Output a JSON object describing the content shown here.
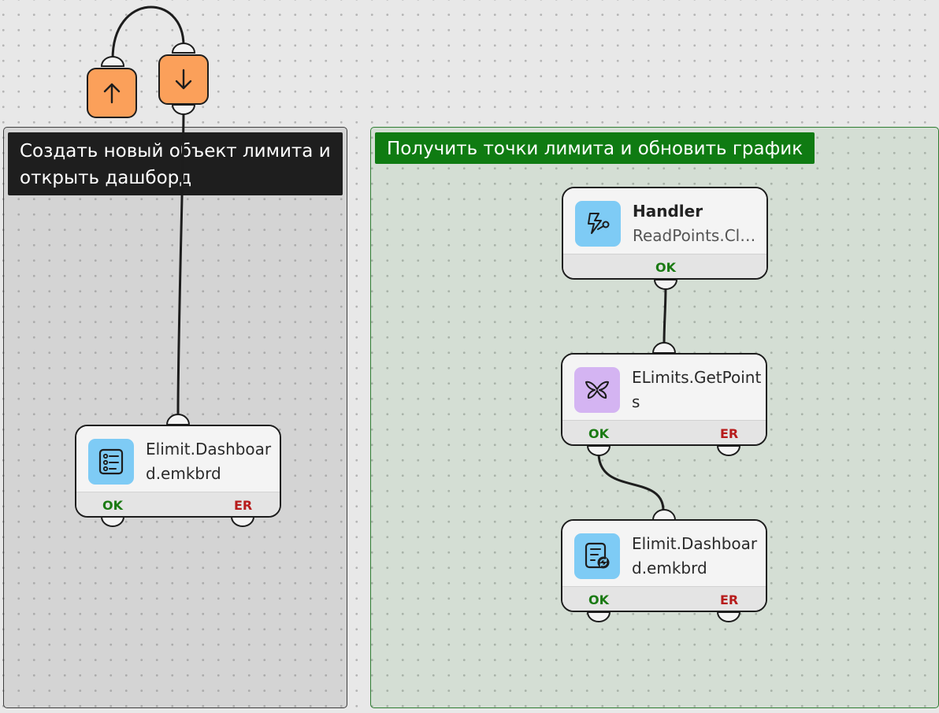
{
  "groups": {
    "left": {
      "title": "Создать новый объект лимита и открыть дашборд"
    },
    "right": {
      "title": "Получить точки лимита и обновить график"
    }
  },
  "colors": {
    "canvas": "#e8e8e8",
    "left_title_bg": "#1e1e1e",
    "right_title_bg": "#0f7b12",
    "right_border": "#2e7d32",
    "pill_orange": "#fba05a",
    "icon_blue": "#7ecbf5",
    "icon_purple": "#d4b4f2",
    "ok_green": "#1a7a12",
    "er_red": "#b71c1c"
  },
  "pills": [
    {
      "icon": "arrow-up-icon"
    },
    {
      "icon": "arrow-down-icon"
    }
  ],
  "nodes": {
    "left_dashboard": {
      "icon": "list-form-icon",
      "label": "Elimit.Dashboard.emkbrd",
      "ok": "OK",
      "er": "ER"
    },
    "handler": {
      "icon": "handler-bolt-icon",
      "title": "Handler",
      "subtitle": "ReadPoints.Cli…",
      "ok": "OK"
    },
    "get_points": {
      "icon": "butterfly-icon",
      "label": "ELimits.GetPoints",
      "ok": "OK",
      "er": "ER"
    },
    "right_dashboard": {
      "icon": "list-refresh-icon",
      "label": "Elimit.Dashboard.emkbrd",
      "ok": "OK",
      "er": "ER"
    }
  }
}
